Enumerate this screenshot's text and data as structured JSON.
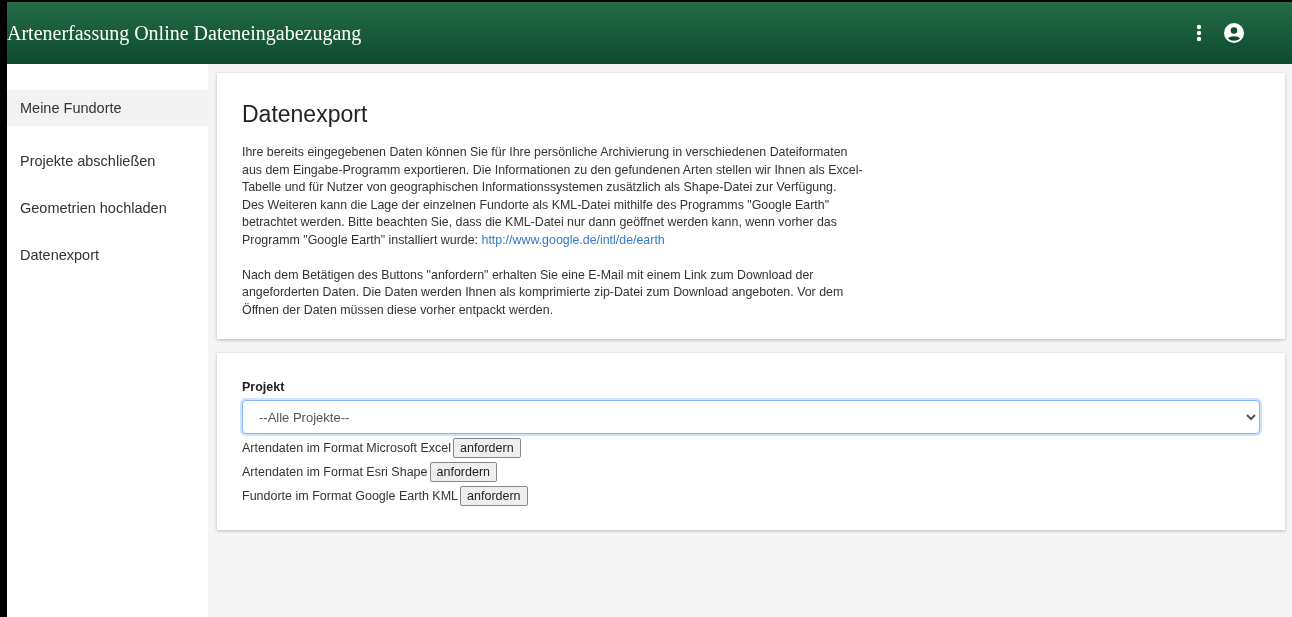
{
  "header": {
    "title": "Artenerfassung Online Dateneingabezugang"
  },
  "sidebar": {
    "items": [
      {
        "label": "Meine Fundorte",
        "selected": true
      },
      {
        "label": "Projekte abschließen",
        "selected": false
      },
      {
        "label": "Geometrien hochladen",
        "selected": false
      },
      {
        "label": "Datenexport",
        "selected": false
      }
    ]
  },
  "info_card": {
    "heading": "Datenexport",
    "paragraph_1": "Ihre bereits eingegebenen Daten können Sie für Ihre persönliche Archivierung in verschiedenen Dateiformaten\naus dem Eingabe-Programm exportieren. Die Informationen zu den gefundenen Arten stellen wir Ihnen als Excel-\nTabelle und für Nutzer von geographischen Informationssystemen zusätzlich als Shape-Datei zur Verfügung.\nDes Weiteren kann die Lage der einzelnen Fundorte als KML-Datei mithilfe des Programms \"Google Earth\"\nbetrachtet werden. Bitte beachten Sie, dass die KML-Datei nur dann geöffnet werden kann, wenn vorher das\nProgramm \"Google Earth\" installiert wurde: ",
    "link": "http://www.google.de/intl/de/earth",
    "paragraph_2": "Nach dem Betätigen des Buttons \"anfordern\" erhalten Sie eine E-Mail mit einem Link zum Download der\nangeforderten Daten. Die Daten werden Ihnen als komprimierte zip-Datei zum Download angeboten. Vor dem\nÖffnen der Daten müssen diese vorher entpackt werden."
  },
  "export_card": {
    "field_label": "Projekt",
    "select_value": "--Alle Projekte--",
    "exports": [
      {
        "label": "Artendaten im Format Microsoft Excel",
        "button": "anfordern"
      },
      {
        "label": "Artendaten im Format Esri Shape",
        "button": "anfordern"
      },
      {
        "label": "Fundorte im Format Google Earth KML",
        "button": "anfordern"
      }
    ]
  }
}
